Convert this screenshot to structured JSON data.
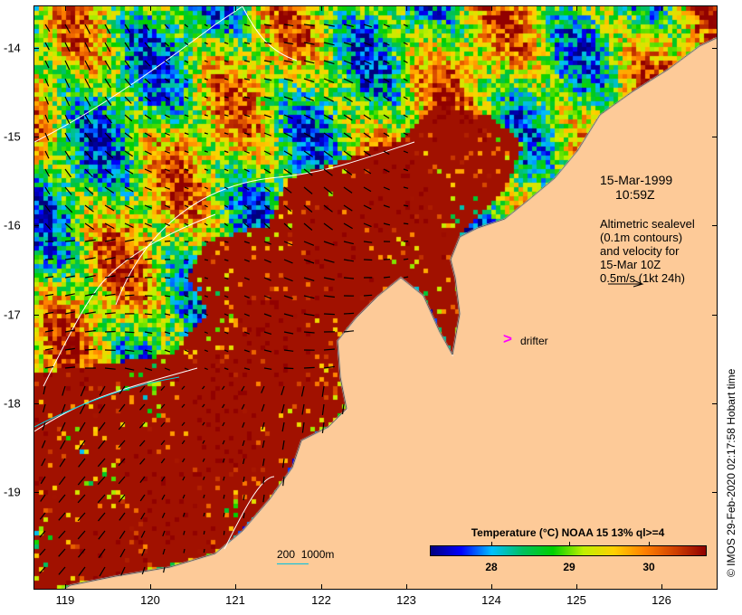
{
  "map": {
    "x_axis": {
      "ticks": [
        "119",
        "120",
        "121",
        "122",
        "123",
        "124",
        "125",
        "126"
      ]
    },
    "y_axis": {
      "ticks": [
        "-14",
        "-15",
        "-16",
        "-17",
        "-18",
        "-19"
      ]
    },
    "land_color": "#fdca98",
    "deep_warm_color": "#a00000"
  },
  "annotations": {
    "date": "15-Mar-1999",
    "time": "10:59Z",
    "altimetry": "Altimetric sealevel\n(0.1m contours)\nand velocity for\n15-Mar 10Z\n0.5m/s (1kt 24h)",
    "drifter_symbol": ">",
    "drifter_label": "drifter",
    "drifter_color": "#ff00ff",
    "scale_label": "200  1000m",
    "scale_color": "#00c0e0"
  },
  "colorbar": {
    "title": "Temperature (°C) NOAA 15 13% ql>=4",
    "ticks": [
      "28",
      "29",
      "30"
    ],
    "colors": [
      "#00007f",
      "#0000ff",
      "#00bfff",
      "#00c060",
      "#00d000",
      "#c0f000",
      "#ffd000",
      "#ff8000",
      "#d04000",
      "#900000"
    ]
  },
  "credit": "© IMOS 29-Feb-2020 02:17:58 Hobart time"
}
